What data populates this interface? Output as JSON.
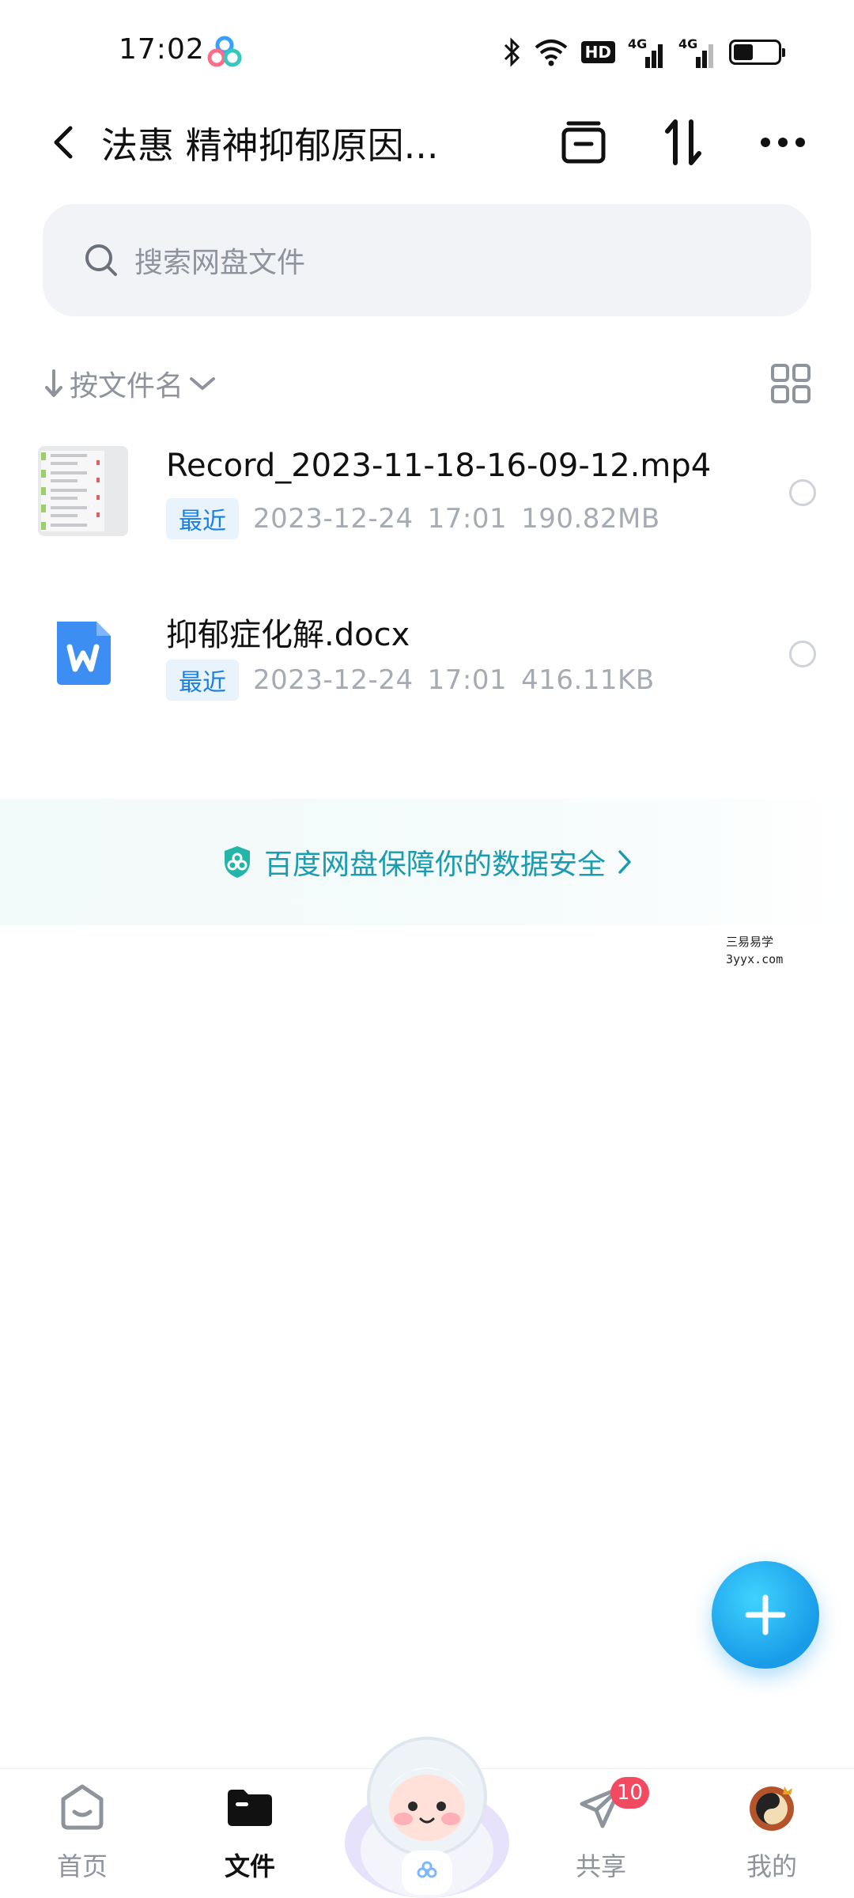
{
  "status_bar": {
    "time": "17:02",
    "icons": [
      "baidu-netdisk-icon",
      "bluetooth-icon",
      "wifi-icon",
      "hd-icon",
      "signal-4g-icon",
      "signal-4g-icon",
      "battery-icon"
    ],
    "hd_label": "HD",
    "network_label": "4G",
    "battery_level": 0.45
  },
  "nav": {
    "title": "法惠 精神抑郁原因...",
    "icons": [
      "back-icon",
      "inbox-icon",
      "sort-transfer-icon",
      "more-icon"
    ]
  },
  "search": {
    "placeholder": "搜索网盘文件",
    "icon": "search-icon"
  },
  "sort": {
    "label": "按文件名",
    "icons": [
      "arrow-down-icon",
      "chevron-down-icon",
      "grid-view-icon"
    ]
  },
  "files": [
    {
      "name": "Record_2023-11-18-16-09-12.mp4",
      "tag": "最近",
      "date": "2023-12-24",
      "time": "17:01",
      "size": "190.82MB",
      "icon": "video-thumbnail"
    },
    {
      "name": "抑郁症化解.docx",
      "tag": "最近",
      "date": "2023-12-24",
      "time": "17:01",
      "size": "416.11KB",
      "icon": "word-doc-icon"
    }
  ],
  "security_banner": {
    "text": "百度网盘保障你的数据安全",
    "icon": "shield-icon"
  },
  "watermark": {
    "line1": "三易易学",
    "line2": "3yyx.com"
  },
  "fab": {
    "icon": "plus-icon"
  },
  "tabs": [
    {
      "label": "首页",
      "icon": "home-icon",
      "active": false
    },
    {
      "label": "文件",
      "icon": "folder-icon",
      "active": true
    },
    {
      "label": "",
      "icon": "mascot-icon",
      "active": false
    },
    {
      "label": "共享",
      "icon": "send-icon",
      "active": false,
      "badge": "10"
    },
    {
      "label": "我的",
      "icon": "avatar-icon",
      "active": false
    }
  ],
  "colors": {
    "accent": "#199be8",
    "security_text": "#1a9bb0",
    "badge": "#f24a60",
    "muted": "#8e939c"
  }
}
